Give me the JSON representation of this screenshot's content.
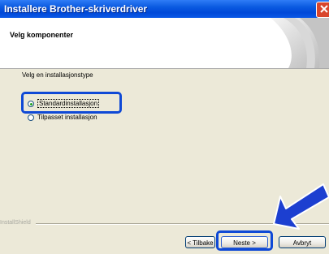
{
  "window": {
    "title": "Installere Brother-skriverdriver"
  },
  "header": {
    "title": "Velg komponenter"
  },
  "body": {
    "prompt": "Velg en installasjonstype",
    "options": [
      {
        "label": "Standardinstallasjon",
        "selected": true
      },
      {
        "label": "Tilpasset installasjon",
        "selected": false
      }
    ]
  },
  "footer": {
    "brand": "InstallShield",
    "back_label": "< Tilbake",
    "next_label": "Neste >",
    "cancel_label": "Avbryt"
  },
  "colors": {
    "title_bar": "#0a5ae0",
    "highlight": "#0f49d6",
    "dialog_bg": "#ece9d8"
  },
  "icons": {
    "close": "close-icon",
    "logo": "brother-logo-graphic",
    "arrow": "pointer-arrow-icon"
  }
}
